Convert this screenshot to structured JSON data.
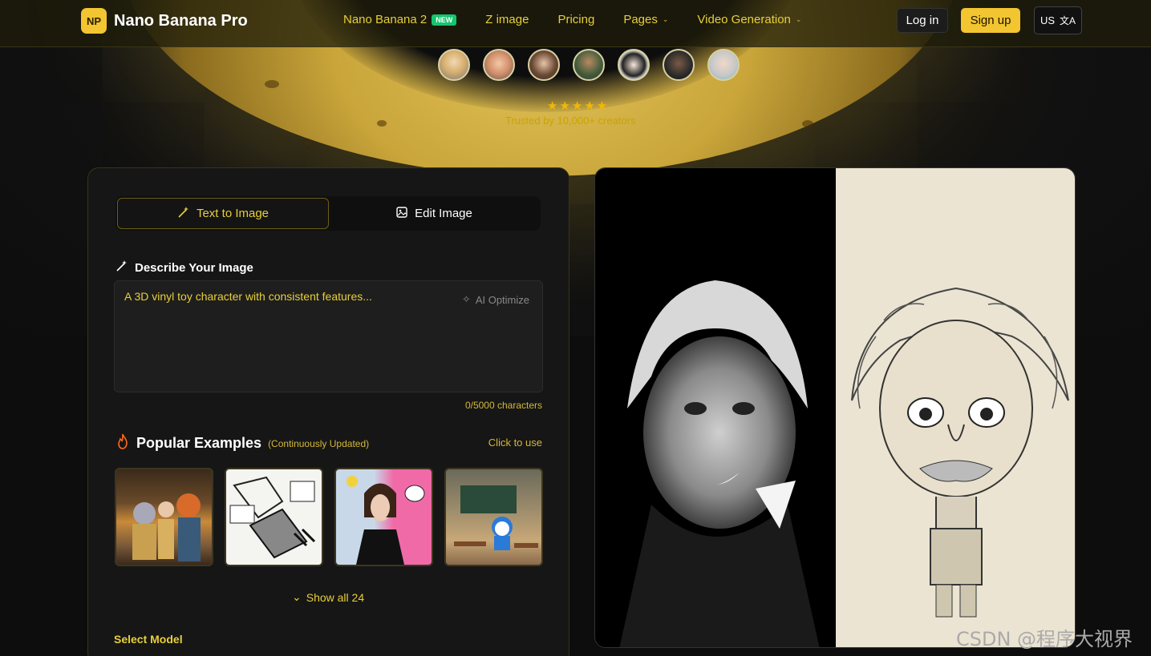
{
  "header": {
    "brand": "Nano Banana Pro",
    "logo_mark": "NP",
    "nav": [
      {
        "label": "Nano Banana 2",
        "badge": "NEW"
      },
      {
        "label": "Z image"
      },
      {
        "label": "Pricing"
      },
      {
        "label": "Pages",
        "dropdown": true
      },
      {
        "label": "Video Generation",
        "dropdown": true
      }
    ],
    "login_label": "Log in",
    "signup_label": "Sign up",
    "lang_label": "US",
    "lang_icon": "translate-icon"
  },
  "hero": {
    "stars": "★★★★★",
    "trust_text": "Trusted by 10,000+ creators"
  },
  "generator": {
    "tabs": [
      {
        "label": "Text to Image",
        "icon": "magic-wand-icon",
        "active": true
      },
      {
        "label": "Edit Image",
        "icon": "image-icon",
        "active": false
      }
    ],
    "describe_label": "Describe Your Image",
    "prompt_placeholder": "A 3D vinyl toy character with consistent features...",
    "ai_optimize_label": "AI Optimize",
    "char_count": "0/5000 characters",
    "examples_title": "Popular Examples",
    "examples_sub": "(Continuously Updated)",
    "click_to_use": "Click to use",
    "show_all": "Show all 24",
    "select_model": "Select Model"
  },
  "watermark": "CSDN @程序大视界",
  "colors": {
    "accent": "#e8cf3a",
    "brand_yellow": "#f2c531",
    "new_badge": "#15c56e",
    "panel_bg": "#161616"
  }
}
